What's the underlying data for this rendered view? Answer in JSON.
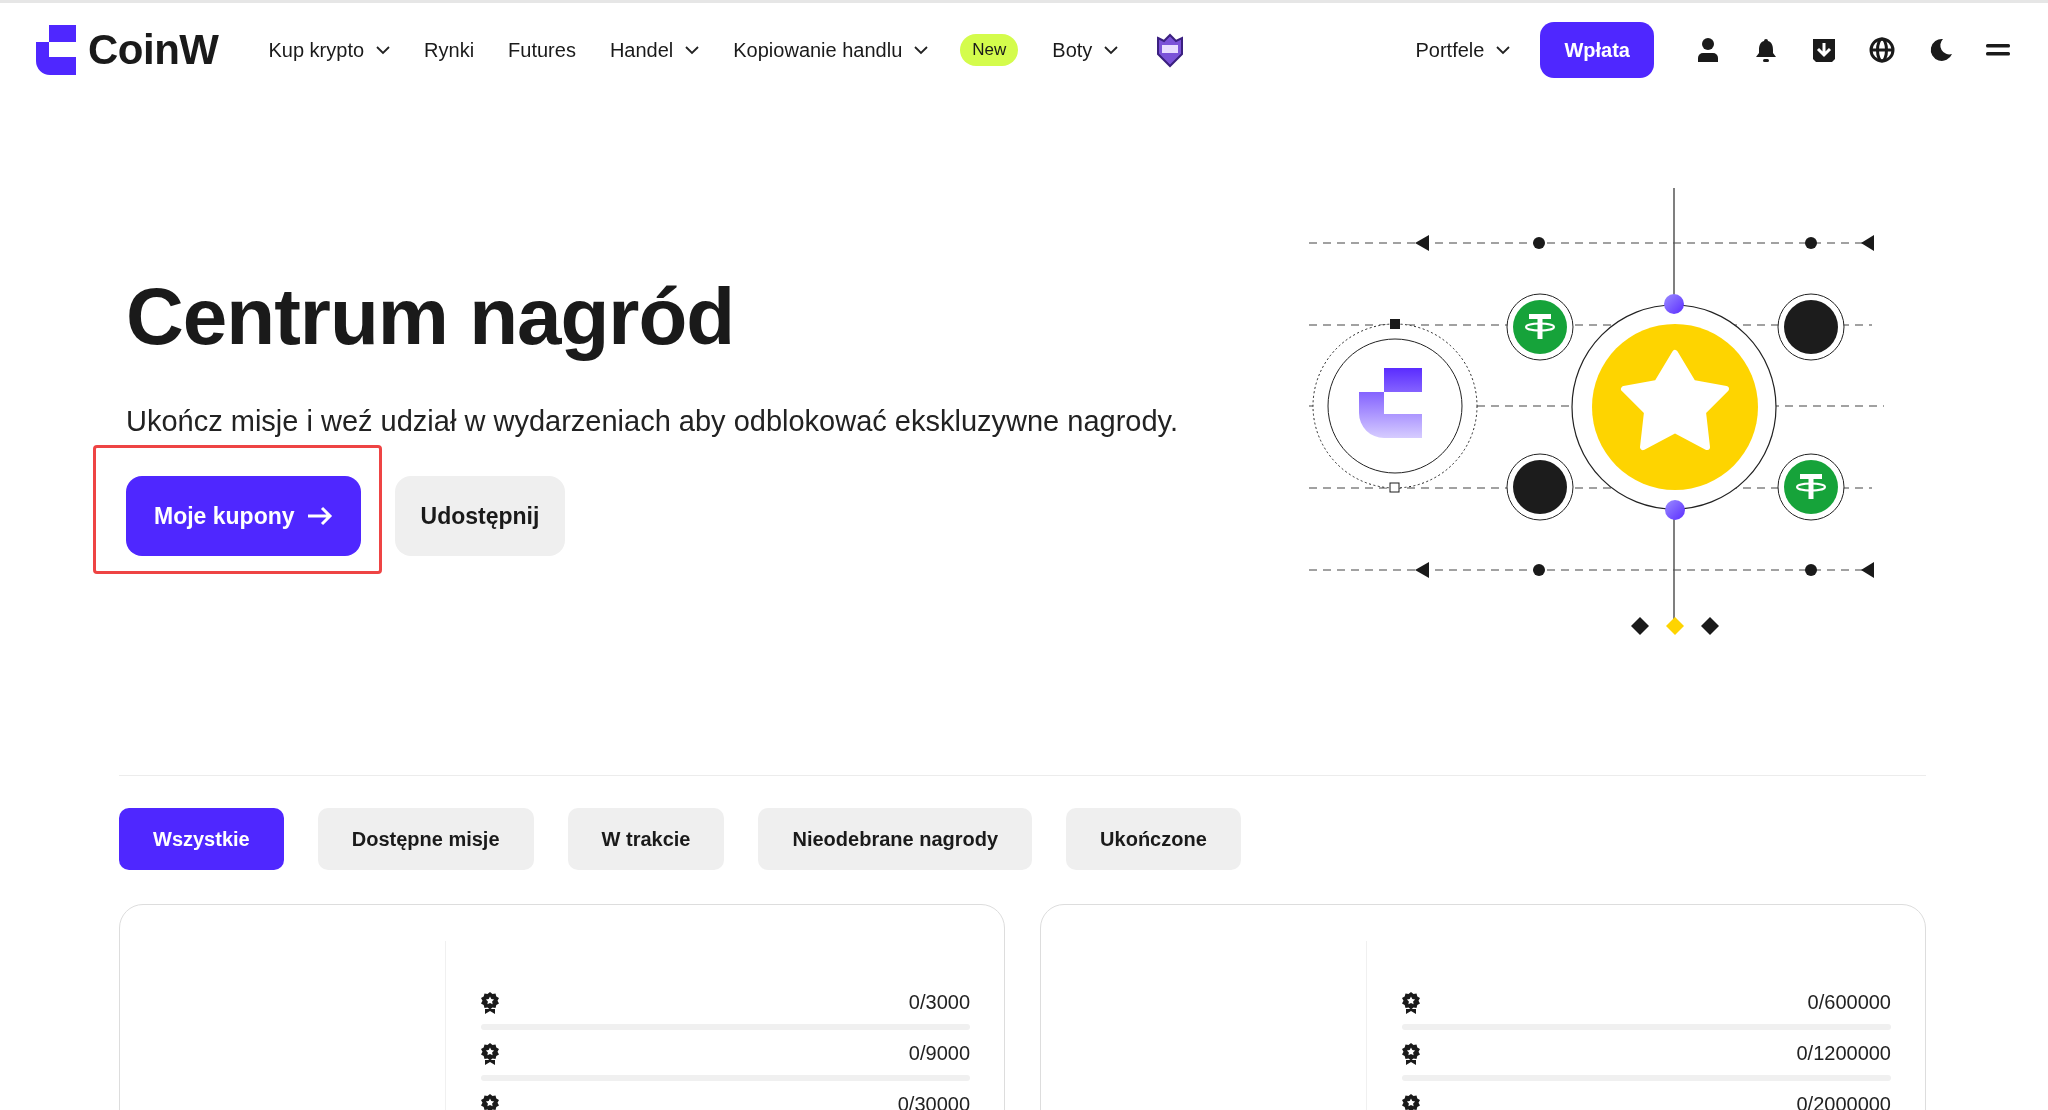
{
  "header": {
    "logo": "CoinW",
    "nav": [
      {
        "label": "Kup krypto",
        "dropdown": true
      },
      {
        "label": "Rynki",
        "dropdown": false
      },
      {
        "label": "Futures",
        "dropdown": false
      },
      {
        "label": "Handel",
        "dropdown": true
      },
      {
        "label": "Kopiowanie handlu",
        "dropdown": true,
        "badge": "New"
      },
      {
        "label": "Boty",
        "dropdown": true
      }
    ],
    "wallets": {
      "label": "Portfele",
      "dropdown": true
    },
    "deposit_button": "Wpłata"
  },
  "hero": {
    "title": "Centrum nagród",
    "subtitle": "Ukończ misje i weź udział w wydarzeniach aby odblokować ekskluzywne nagrody.",
    "primary_button": {
      "label": "Moje kupony",
      "highlighted": true
    },
    "secondary_button": "Udostępnij"
  },
  "tabs": [
    {
      "label": "Wszystkie",
      "selected": true
    },
    {
      "label": "Dostępne misje",
      "selected": false
    },
    {
      "label": "W trakcie",
      "selected": false
    },
    {
      "label": "Nieodebrane nagrody",
      "selected": false
    },
    {
      "label": "Ukończone",
      "selected": false
    }
  ],
  "missions": [
    {
      "rewards": [
        {
          "progress": "0/3000",
          "level": 0
        },
        {
          "progress": "0/9000",
          "level": 0
        },
        {
          "progress": "0/30000"
        }
      ]
    },
    {
      "rewards": [
        {
          "progress": "0/600000",
          "level": 0
        },
        {
          "progress": "0/1200000",
          "level": 0
        },
        {
          "progress": "0/2000000"
        }
      ]
    }
  ]
}
